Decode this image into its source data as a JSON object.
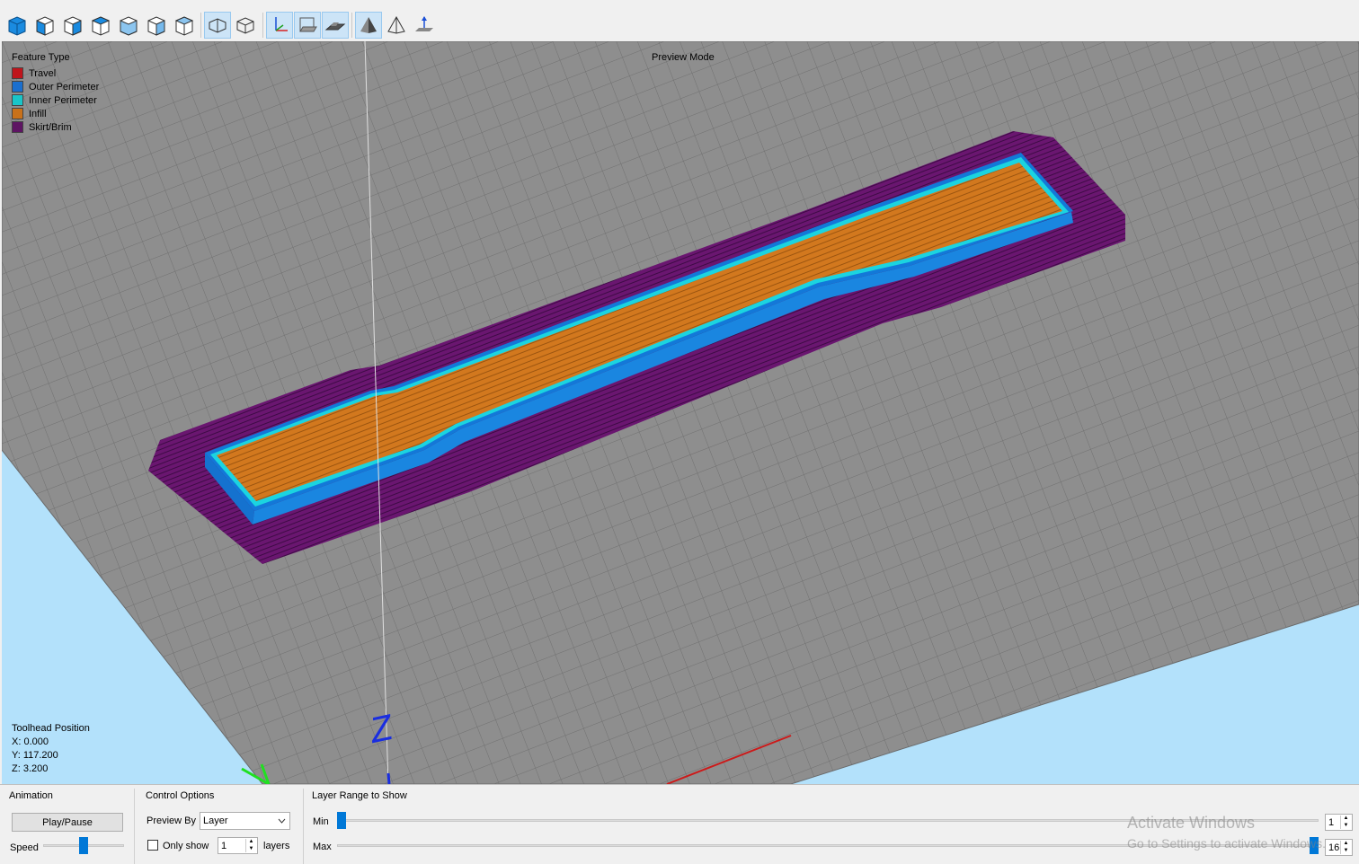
{
  "toolbar": {
    "buttons": [
      {
        "name": "view-iso-cube-icon"
      },
      {
        "name": "view-front-icon"
      },
      {
        "name": "view-back-icon"
      },
      {
        "name": "view-left-icon"
      },
      {
        "name": "view-right-icon"
      },
      {
        "name": "view-top-icon"
      },
      {
        "name": "view-bottom-icon"
      },
      {
        "name": "perspective-toggle-icon"
      },
      {
        "name": "orthographic-toggle-icon"
      },
      {
        "name": "show-axes-icon"
      },
      {
        "name": "show-build-volume-icon"
      },
      {
        "name": "show-bed-icon"
      },
      {
        "name": "solid-model-icon"
      },
      {
        "name": "transparent-model-icon"
      },
      {
        "name": "move-to-origin-icon"
      }
    ]
  },
  "viewport": {
    "preview_mode_label": "Preview Mode",
    "legend": {
      "title": "Feature Type",
      "items": [
        {
          "label": "Travel",
          "color": "#c0141b"
        },
        {
          "label": "Outer Perimeter",
          "color": "#1a6fcf"
        },
        {
          "label": "Inner Perimeter",
          "color": "#19c5c8"
        },
        {
          "label": "Infill",
          "color": "#c9711a"
        },
        {
          "label": "Skirt/Brim",
          "color": "#5e1463"
        }
      ]
    },
    "toolhead": {
      "title": "Toolhead Position",
      "x": "X: 0.000",
      "y": "Y: 117.200",
      "z": "Z: 3.200"
    },
    "axis_label": "Z"
  },
  "bottom_panel": {
    "animation": {
      "title": "Animation",
      "play_pause_label": "Play/Pause",
      "speed_label": "Speed",
      "speed_value": 0.65
    },
    "control_options": {
      "title": "Control Options",
      "preview_by_label": "Preview By",
      "preview_by_value": "Layer",
      "only_show_label": "Only show",
      "only_show_checked": false,
      "only_show_count": "1",
      "layers_label": "layers"
    },
    "layer_range": {
      "title": "Layer Range to Show",
      "min_label": "Min",
      "min_value": "1",
      "max_label": "Max",
      "max_value": "16"
    },
    "watermark": {
      "line1": "Activate Windows",
      "line2": "Go to Settings to activate Windows."
    }
  }
}
